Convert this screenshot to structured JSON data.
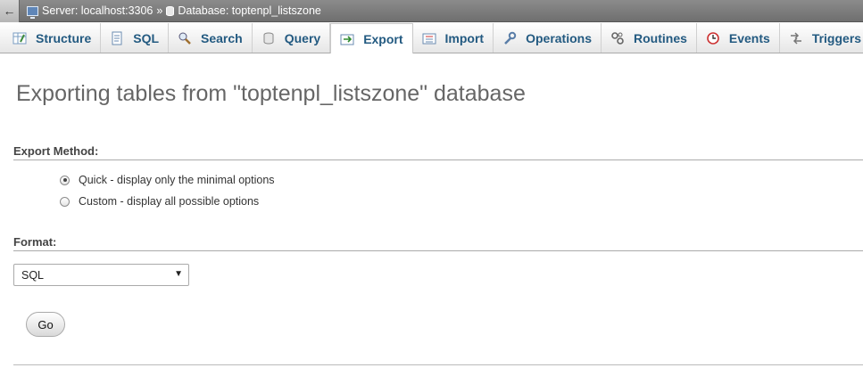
{
  "breadcrumb": {
    "back_glyph": "←",
    "server_label": "Server: localhost:3306",
    "separator": "»",
    "database_label": "Database: toptenpl_listszone"
  },
  "tabs": [
    {
      "label": "Structure",
      "icon": "structure-icon"
    },
    {
      "label": "SQL",
      "icon": "sql-icon"
    },
    {
      "label": "Search",
      "icon": "search-icon"
    },
    {
      "label": "Query",
      "icon": "query-icon"
    },
    {
      "label": "Export",
      "icon": "export-icon",
      "active": true
    },
    {
      "label": "Import",
      "icon": "import-icon"
    },
    {
      "label": "Operations",
      "icon": "wrench-icon"
    },
    {
      "label": "Routines",
      "icon": "routines-icon"
    },
    {
      "label": "Events",
      "icon": "clock-icon"
    },
    {
      "label": "Triggers",
      "icon": "triggers-icon"
    }
  ],
  "main": {
    "title": "Exporting tables from \"toptenpl_listszone\" database",
    "export_method": {
      "heading": "Export Method:",
      "options": [
        {
          "label": "Quick - display only the minimal options",
          "checked": true
        },
        {
          "label": "Custom - display all possible options",
          "checked": false
        }
      ]
    },
    "format": {
      "heading": "Format:",
      "selected": "SQL"
    },
    "go_label": "Go"
  },
  "colors": {
    "tab_text": "#235a81",
    "title_text": "#666666",
    "crumb_bar": "#7a7a7a"
  }
}
